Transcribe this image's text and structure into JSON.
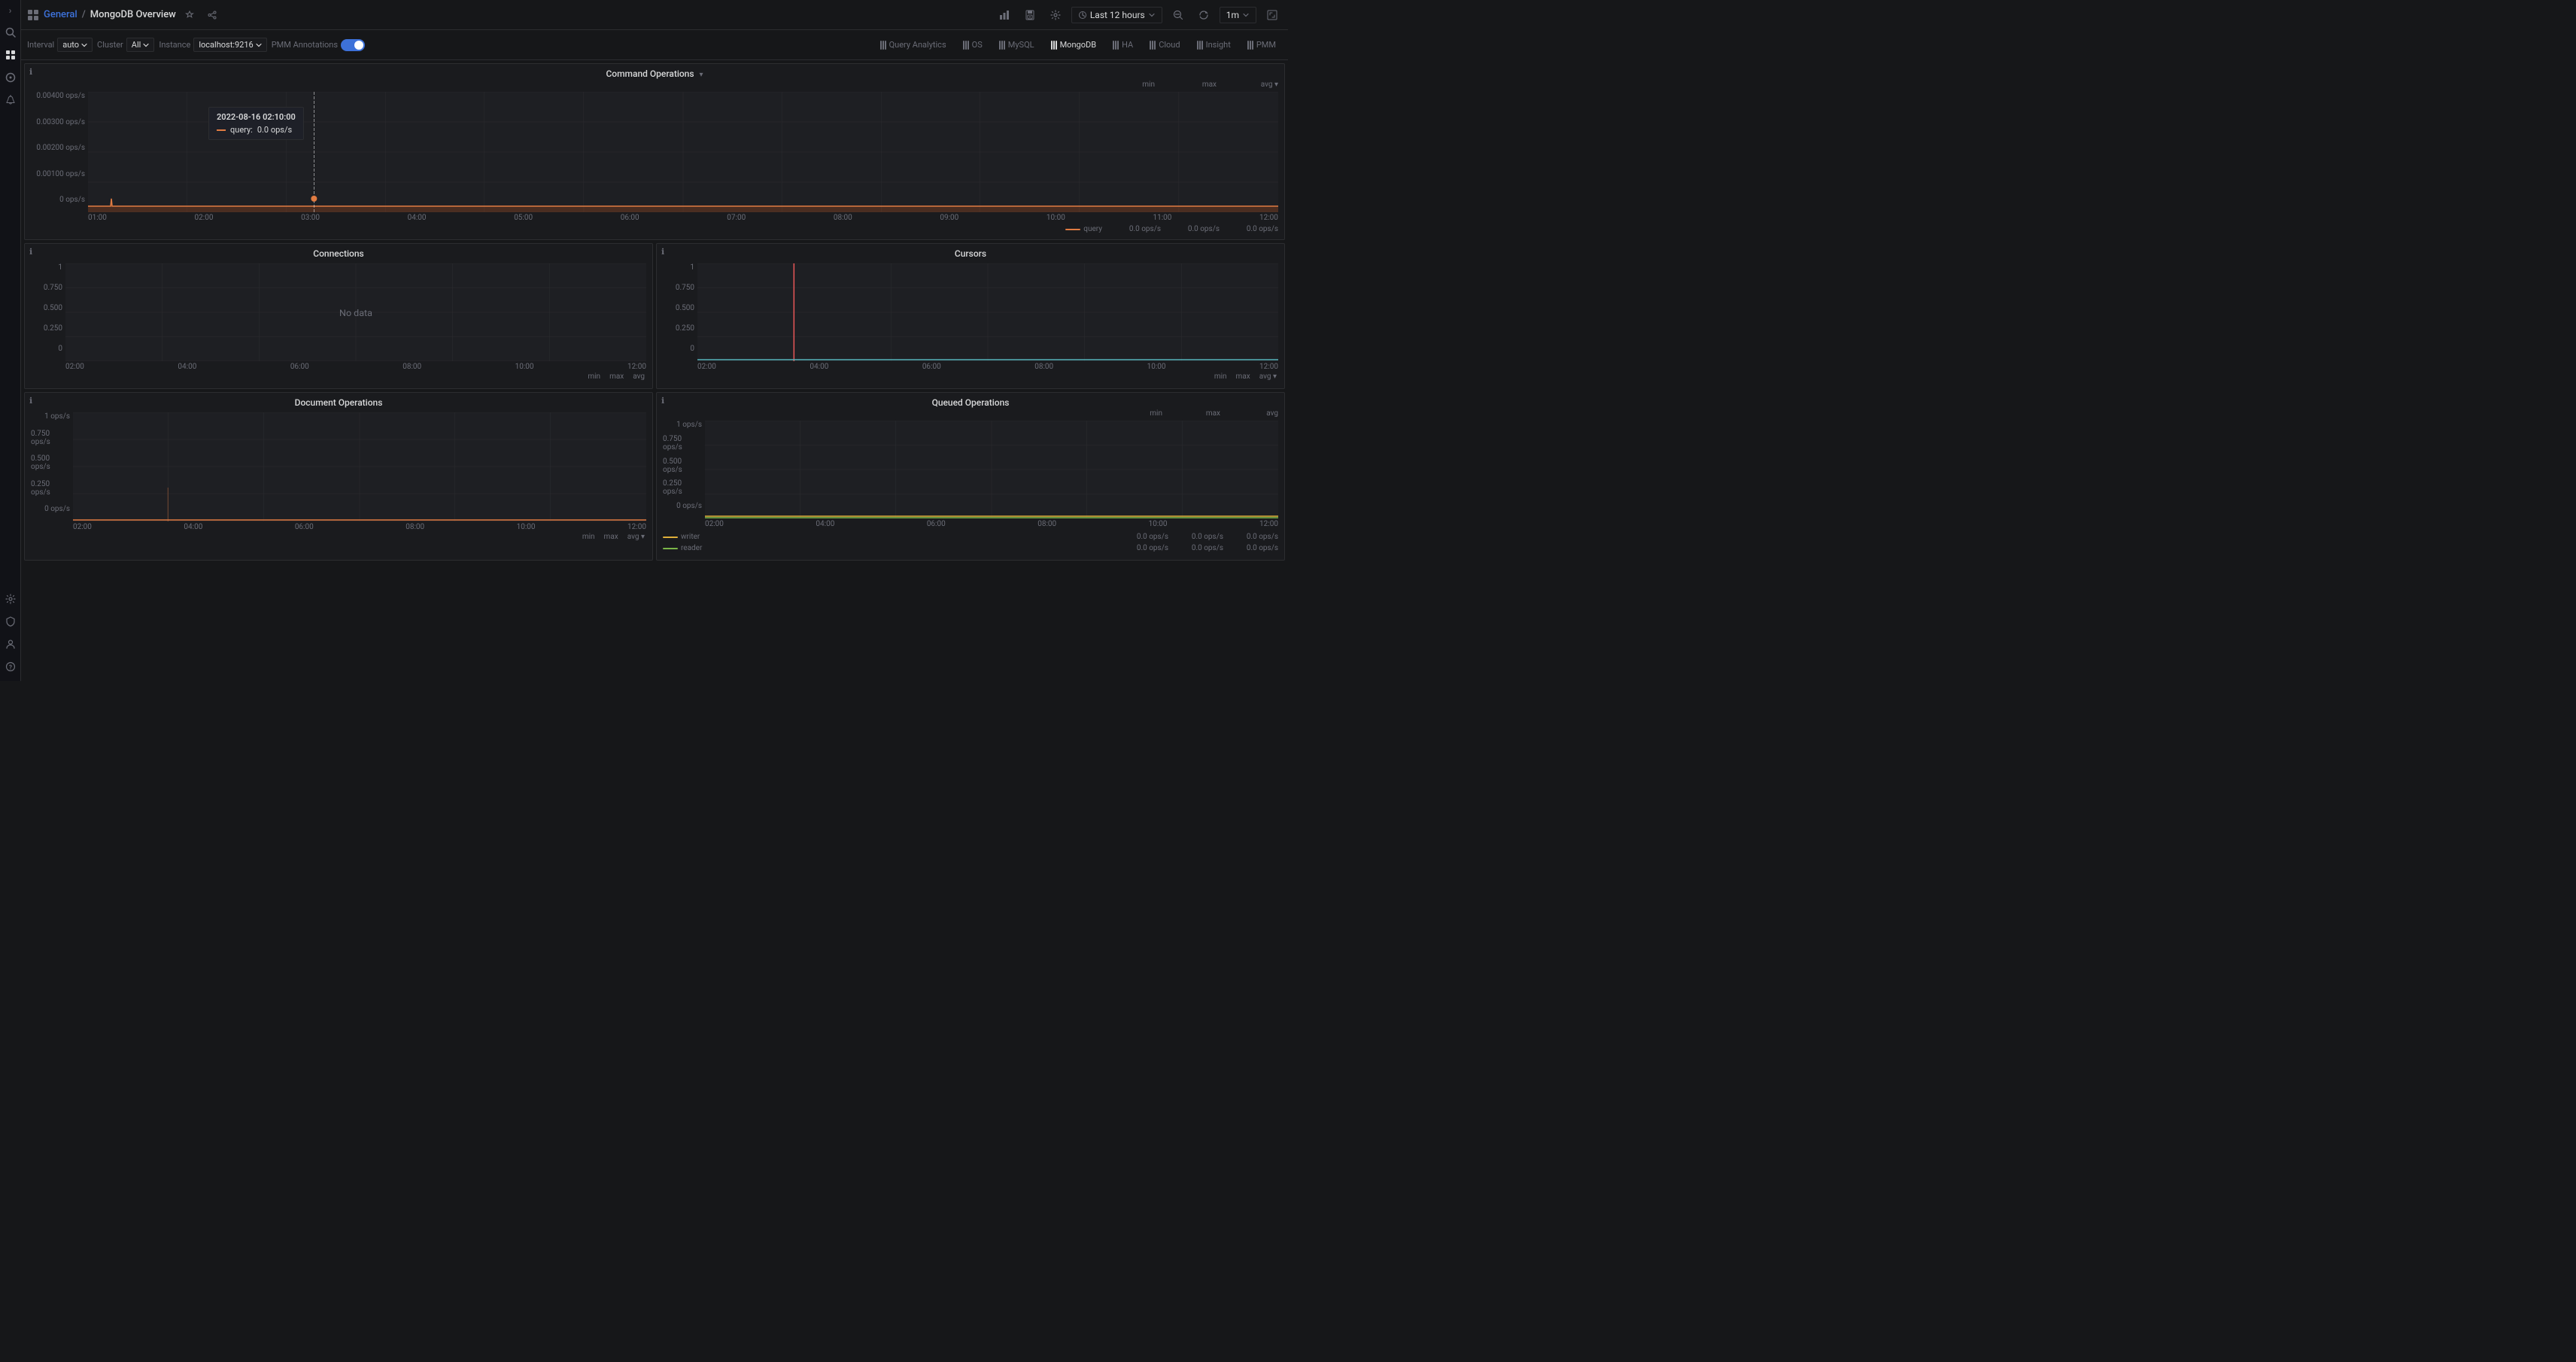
{
  "app": {
    "title": "General",
    "subtitle": "MongoDB Overview",
    "sidebar_toggle": "›"
  },
  "header": {
    "time_label": "Last 12 hours",
    "interval_label": "1m"
  },
  "toolbar": {
    "interval_label": "Interval",
    "interval_value": "auto",
    "cluster_label": "Cluster",
    "cluster_value": "All",
    "instance_label": "Instance",
    "instance_value": "localhost:9216",
    "annotations_label": "PMM Annotations",
    "nav_tabs": [
      {
        "label": "Query Analytics",
        "id": "query-analytics"
      },
      {
        "label": "OS",
        "id": "os"
      },
      {
        "label": "MySQL",
        "id": "mysql"
      },
      {
        "label": "MongoDB",
        "id": "mongodb"
      },
      {
        "label": "HA",
        "id": "ha"
      },
      {
        "label": "Cloud",
        "id": "cloud"
      },
      {
        "label": "Insight",
        "id": "insight"
      },
      {
        "label": "PMM",
        "id": "pmm"
      }
    ]
  },
  "panels": {
    "command_operations": {
      "title": "Command Operations",
      "y_labels": [
        "0.00400 ops/s",
        "0.00300 ops/s",
        "0.00200 ops/s",
        "0.00100 ops/s",
        "0 ops/s"
      ],
      "x_labels": [
        "01:00",
        "02:00",
        "03:00",
        "04:00",
        "05:00",
        "06:00",
        "07:00",
        "08:00",
        "09:00",
        "10:00",
        "11:00",
        "12:00"
      ],
      "legend": {
        "headers": [
          "min",
          "max",
          "avg"
        ],
        "items": [
          {
            "label": "query",
            "color": "#e07b42",
            "min": "0.0 ops/s",
            "max": "0.0 ops/s",
            "avg": "0.0 ops/s"
          }
        ]
      },
      "tooltip": {
        "time": "2022-08-16 02:10:00",
        "rows": [
          {
            "label": "query",
            "value": "0.0 ops/s",
            "color": "#e07b42"
          }
        ]
      }
    },
    "connections": {
      "title": "Connections",
      "y_labels": [
        "1",
        "0.750",
        "0.500",
        "0.250",
        "0"
      ],
      "x_labels": [
        "02:00",
        "04:00",
        "06:00",
        "08:00",
        "10:00",
        "12:00"
      ],
      "no_data": true,
      "legend": {
        "items_footer": [
          "min",
          "max",
          "avg"
        ]
      }
    },
    "cursors": {
      "title": "Cursors",
      "y_labels": [
        "1",
        "0.750",
        "0.500",
        "0.250",
        "0"
      ],
      "x_labels": [
        "02:00",
        "04:00",
        "06:00",
        "08:00",
        "10:00",
        "12:00"
      ],
      "legend": {
        "items_footer": [
          "min",
          "max",
          "avg ▾"
        ]
      }
    },
    "document_operations": {
      "title": "Document Operations",
      "y_labels": [
        "1 ops/s",
        "0.750 ops/s",
        "0.500 ops/s",
        "0.250 ops/s",
        "0 ops/s"
      ],
      "x_labels": [
        "02:00",
        "04:00",
        "06:00",
        "08:00",
        "10:00",
        "12:00"
      ],
      "legend": {
        "items_footer": [
          "min",
          "max",
          "avg ▾"
        ]
      }
    },
    "queued_operations": {
      "title": "Queued Operations",
      "y_labels": [
        "1 ops/s",
        "0.750 ops/s",
        "0.500 ops/s",
        "0.250 ops/s",
        "0 ops/s"
      ],
      "x_labels": [
        "02:00",
        "04:00",
        "06:00",
        "08:00",
        "10:00",
        "12:00"
      ],
      "legend": {
        "headers": [
          "min",
          "max",
          "avg"
        ],
        "items": [
          {
            "label": "writer",
            "color": "#e0b03a",
            "min": "0.0 ops/s",
            "max": "0.0 ops/s",
            "avg": "0.0 ops/s"
          },
          {
            "label": "reader",
            "color": "#7ab648",
            "min": "0.0 ops/s",
            "max": "0.0 ops/s",
            "avg": "0.0 ops/s"
          }
        ]
      }
    }
  },
  "sidebar_icons": [
    {
      "name": "search",
      "symbol": "🔍"
    },
    {
      "name": "dashboard",
      "symbol": "▦"
    },
    {
      "name": "compass",
      "symbol": "◎"
    },
    {
      "name": "bell",
      "symbol": "🔔"
    },
    {
      "name": "settings",
      "symbol": "⚙"
    },
    {
      "name": "shield",
      "symbol": "🛡"
    },
    {
      "name": "user",
      "symbol": "👤"
    },
    {
      "name": "help",
      "symbol": "?"
    }
  ]
}
